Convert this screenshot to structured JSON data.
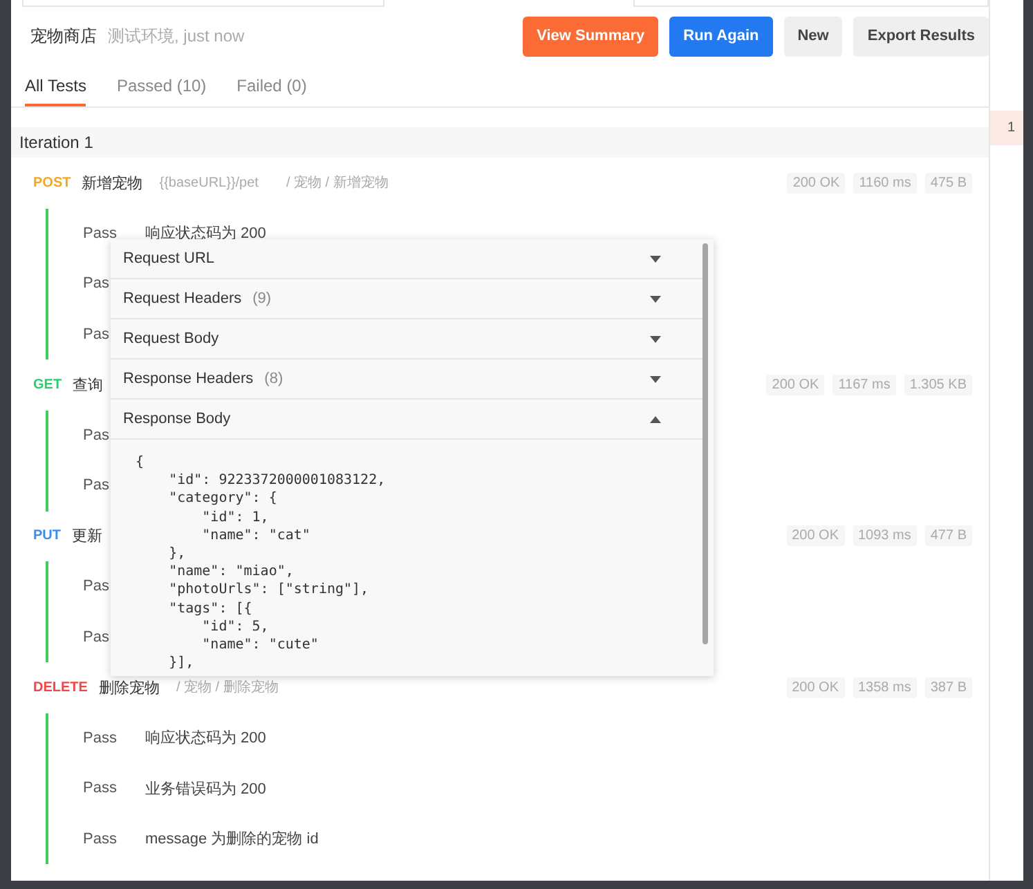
{
  "header": {
    "title": "宠物商店",
    "subtitle": "测试环境, just now"
  },
  "buttons": [
    {
      "label": "View Summary",
      "kind": "orange"
    },
    {
      "label": "Run Again",
      "kind": "blue"
    },
    {
      "label": "New",
      "kind": "plain"
    },
    {
      "label": "Export Results",
      "kind": "plain"
    }
  ],
  "tabs": [
    {
      "label": "All Tests",
      "selected": true
    },
    {
      "label": "Passed (10)",
      "selected": false
    },
    {
      "label": "Failed (0)",
      "selected": false
    }
  ],
  "iteration": {
    "title": "Iteration 1"
  },
  "requests": [
    {
      "method": "POST",
      "color": "#f5a623",
      "name": "新增宠物",
      "url": "{{baseURL}}/pet",
      "path": "/ 宠物 / 新增宠物",
      "status": "200 OK",
      "time": "1160 ms",
      "size": "475 B",
      "tests": [
        {
          "result": "Pass",
          "name": "响应状态码为 200"
        },
        {
          "result": "Pas"
        },
        {
          "result": "Pas"
        }
      ]
    },
    {
      "method": "GET",
      "color": "#2ecc71",
      "name": "查询",
      "status": "200 OK",
      "time": "1167 ms",
      "size": "1.305 KB",
      "tests": [
        {
          "result": "Pas"
        },
        {
          "result": "Pas"
        }
      ]
    },
    {
      "method": "PUT",
      "color": "#3b8ef0",
      "name": "更新",
      "status": "200 OK",
      "time": "1093 ms",
      "size": "477 B",
      "tests": [
        {
          "result": "Pas"
        },
        {
          "result": "Pas"
        }
      ]
    },
    {
      "method": "DELETE",
      "color": "#f04848",
      "name": "删除宠物",
      "path": "/ 宠物 / 删除宠物",
      "status": "200 OK",
      "time": "1358 ms",
      "size": "387 B",
      "tests": [
        {
          "result": "Pass",
          "name": "响应状态码为 200"
        },
        {
          "result": "Pass",
          "name": "业务错误码为 200"
        },
        {
          "result": "Pass",
          "name": "message 为删除的宠物 id"
        }
      ]
    }
  ],
  "iterations": [
    {
      "label": "1",
      "selected": true
    }
  ],
  "popup": {
    "sections": [
      {
        "title": "Request URL",
        "expanded": false
      },
      {
        "title": "Request Headers",
        "count": "(9)",
        "expanded": false
      },
      {
        "title": "Request Body",
        "expanded": false
      },
      {
        "title": "Response Headers",
        "count": "(8)",
        "expanded": false
      },
      {
        "title": "Response Body",
        "expanded": true
      }
    ],
    "body": [
      "{",
      "    \"id\": 9223372000001083122,",
      "    \"category\": {",
      "        \"id\": 1,",
      "        \"name\": \"cat\"",
      "    },",
      "    \"name\": \"miao\",",
      "    \"photoUrls\": [\"string\"],",
      "    \"tags\": [{",
      "        \"id\": 5,",
      "        \"name\": \"cute\"",
      "    }],"
    ]
  }
}
